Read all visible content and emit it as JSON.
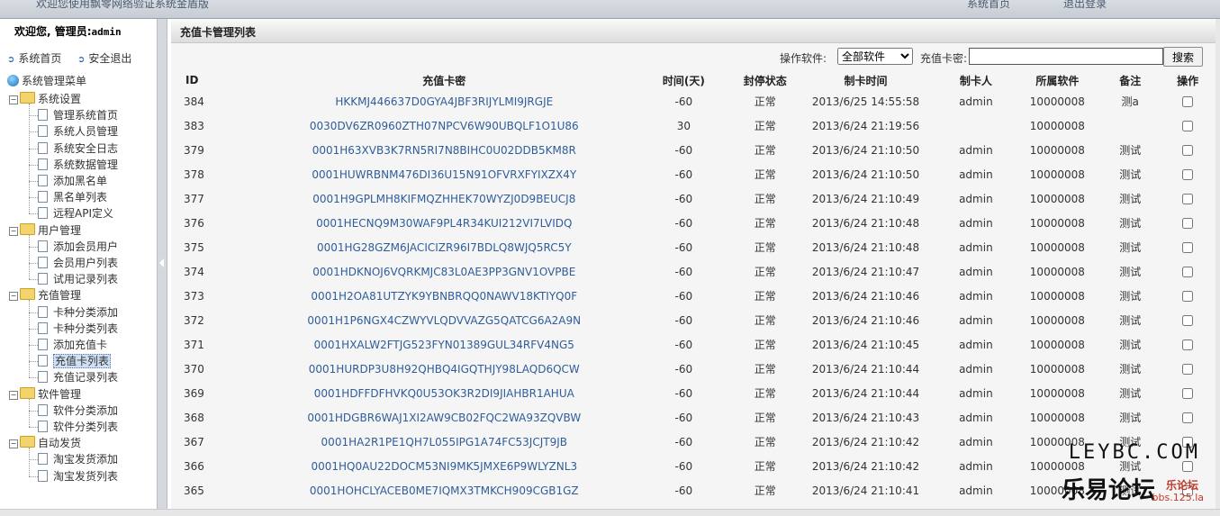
{
  "topbar": {
    "welcome": "欢迎您使用飘零网络验证系统金盾版",
    "nav_home": "系统首页",
    "nav_logout": "退出登录"
  },
  "sidebar": {
    "hello_prefix": "欢迎您, 管理员:",
    "username": "admin",
    "quick_home": "系统首页",
    "quick_logout": "安全退出",
    "root": "系统管理菜单",
    "groups": [
      {
        "label": "系统设置",
        "items": [
          "管理系统首页",
          "系统人员管理",
          "系统安全日志",
          "系统数据管理",
          "添加黑名单",
          "黑名单列表",
          "远程API定义"
        ]
      },
      {
        "label": "用户管理",
        "items": [
          "添加会员用户",
          "会员用户列表",
          "试用记录列表"
        ]
      },
      {
        "label": "充值管理",
        "items": [
          "卡种分类添加",
          "卡种分类列表",
          "添加充值卡",
          "充值卡列表",
          "充值记录列表"
        ]
      },
      {
        "label": "软件管理",
        "items": [
          "软件分类添加",
          "软件分类列表"
        ]
      },
      {
        "label": "自动发货",
        "items": [
          "淘宝发货添加",
          "淘宝发货列表"
        ]
      }
    ],
    "active_item": "充值卡列表"
  },
  "main": {
    "title": "充值卡管理列表",
    "filter": {
      "software_label": "操作软件:",
      "software_selected": "全部软件",
      "card_label": "充值卡密:",
      "card_value": "",
      "search_label": "搜索"
    },
    "columns": [
      "ID",
      "充值卡密",
      "时间(天)",
      "封停状态",
      "制卡时间",
      "制卡人",
      "所属软件",
      "备注",
      "操作"
    ],
    "rows": [
      [
        "384",
        "HKKMJ446637D0GYA4JBF3RIJYLMI9JRGJE",
        "-60",
        "正常",
        "2013/6/25 14:55:58",
        "admin",
        "10000008",
        "测a"
      ],
      [
        "383",
        "0030DV6ZR0960ZTH07NPCV6W90UBQLF1O1U86",
        "30",
        "正常",
        "2013/6/24 21:19:56",
        "",
        "10000008",
        ""
      ],
      [
        "379",
        "0001H63XVB3K7RN5RI7N8BIHC0U02DDB5KM8R",
        "-60",
        "正常",
        "2013/6/24 21:10:50",
        "admin",
        "10000008",
        "测试"
      ],
      [
        "378",
        "0001HUWRBNM476DI36U15N91OFVRXFYIXZX4Y",
        "-60",
        "正常",
        "2013/6/24 21:10:50",
        "admin",
        "10000008",
        "测试"
      ],
      [
        "377",
        "0001H9GPLMH8KIFMQZHHEK70WYZJ0D9BEUCJ8",
        "-60",
        "正常",
        "2013/6/24 21:10:49",
        "admin",
        "10000008",
        "测试"
      ],
      [
        "376",
        "0001HECNQ9M30WAF9PL4R34KUI212VI7LVIDQ",
        "-60",
        "正常",
        "2013/6/24 21:10:48",
        "admin",
        "10000008",
        "测试"
      ],
      [
        "375",
        "0001HG28GZM6JACICIZR96I7BDLQ8WJQ5RC5Y",
        "-60",
        "正常",
        "2013/6/24 21:10:48",
        "admin",
        "10000008",
        "测试"
      ],
      [
        "374",
        "0001HDKNOJ6VQRKMJC83L0AE3PP3GNV1OVPBE",
        "-60",
        "正常",
        "2013/6/24 21:10:47",
        "admin",
        "10000008",
        "测试"
      ],
      [
        "373",
        "0001H2OA81UTZYK9YBNBRQQ0NAWV18KTIYQ0F",
        "-60",
        "正常",
        "2013/6/24 21:10:46",
        "admin",
        "10000008",
        "测试"
      ],
      [
        "372",
        "0001H1P6NGX4CZWYVLQDVVAZG5QATCG6A2A9N",
        "-60",
        "正常",
        "2013/6/24 21:10:46",
        "admin",
        "10000008",
        "测试"
      ],
      [
        "371",
        "0001HXALW2FTJG523FYN01389GUL34RFV4NG5",
        "-60",
        "正常",
        "2013/6/24 21:10:45",
        "admin",
        "10000008",
        "测试"
      ],
      [
        "370",
        "0001HURDP3U8H92QHBQ4IGQTHJY98LAQD6QCW",
        "-60",
        "正常",
        "2013/6/24 21:10:44",
        "admin",
        "10000008",
        "测试"
      ],
      [
        "369",
        "0001HDFFDFHVKQ0U53OK3R2DI9JIAHBR1AHUA",
        "-60",
        "正常",
        "2013/6/24 21:10:44",
        "admin",
        "10000008",
        "测试"
      ],
      [
        "368",
        "0001HDGBR6WAJ1XI2AW9CB02FQC2WA93ZQVBW",
        "-60",
        "正常",
        "2013/6/24 21:10:43",
        "admin",
        "10000008",
        "测试"
      ],
      [
        "367",
        "0001HA2R1PE1QH7L055IPG1A74FC53JCJT9JB",
        "-60",
        "正常",
        "2013/6/24 21:10:42",
        "admin",
        "10000008",
        "测试"
      ],
      [
        "366",
        "0001HQ0AU22DOCM53NI9MK5JMXE6P9WLYZNL3",
        "-60",
        "正常",
        "2013/6/24 21:10:42",
        "admin",
        "10000008",
        "测试"
      ],
      [
        "365",
        "0001HOHCLYACEB0ME7IQMX3TMKCH909CGB1GZ",
        "-60",
        "正常",
        "2013/6/24 21:10:41",
        "admin",
        "10000008",
        "测试"
      ]
    ]
  },
  "watermark": {
    "line1": "LEYBC.COM",
    "line2": "乐易论坛",
    "line3": "乐论坛",
    "line4": "bbs.125.la"
  },
  "colors": {
    "link": "#2f5d9a",
    "panel_bg": "#f5f5f5",
    "accent_red": "#c0392b"
  }
}
